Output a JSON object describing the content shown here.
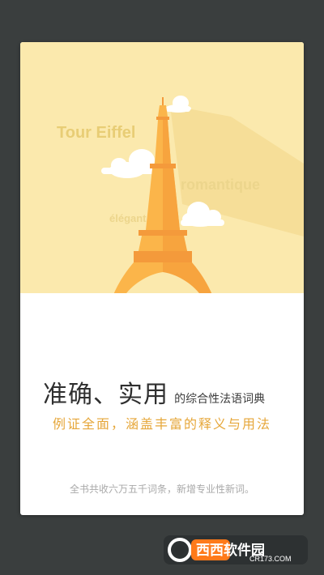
{
  "illustration": {
    "word_tour": "Tour Eiffel",
    "word_romantique": "romantique",
    "word_elegant": "élégant"
  },
  "headline": {
    "main": "准确、实用",
    "sub": "的综合性法语词典"
  },
  "tagline": "例证全面，涵盖丰富的释义与用法",
  "footer_note": "全书共收六万五千词条，新增专业性新词。",
  "watermark": {
    "brand": "西西软件园",
    "url": "CR173.COM"
  },
  "colors": {
    "sky": "#fbe9ad",
    "tower_light": "#fbb54a",
    "tower_dark": "#f49a3b",
    "accent_text": "#e6a73a",
    "background": "#3a3e3e"
  }
}
